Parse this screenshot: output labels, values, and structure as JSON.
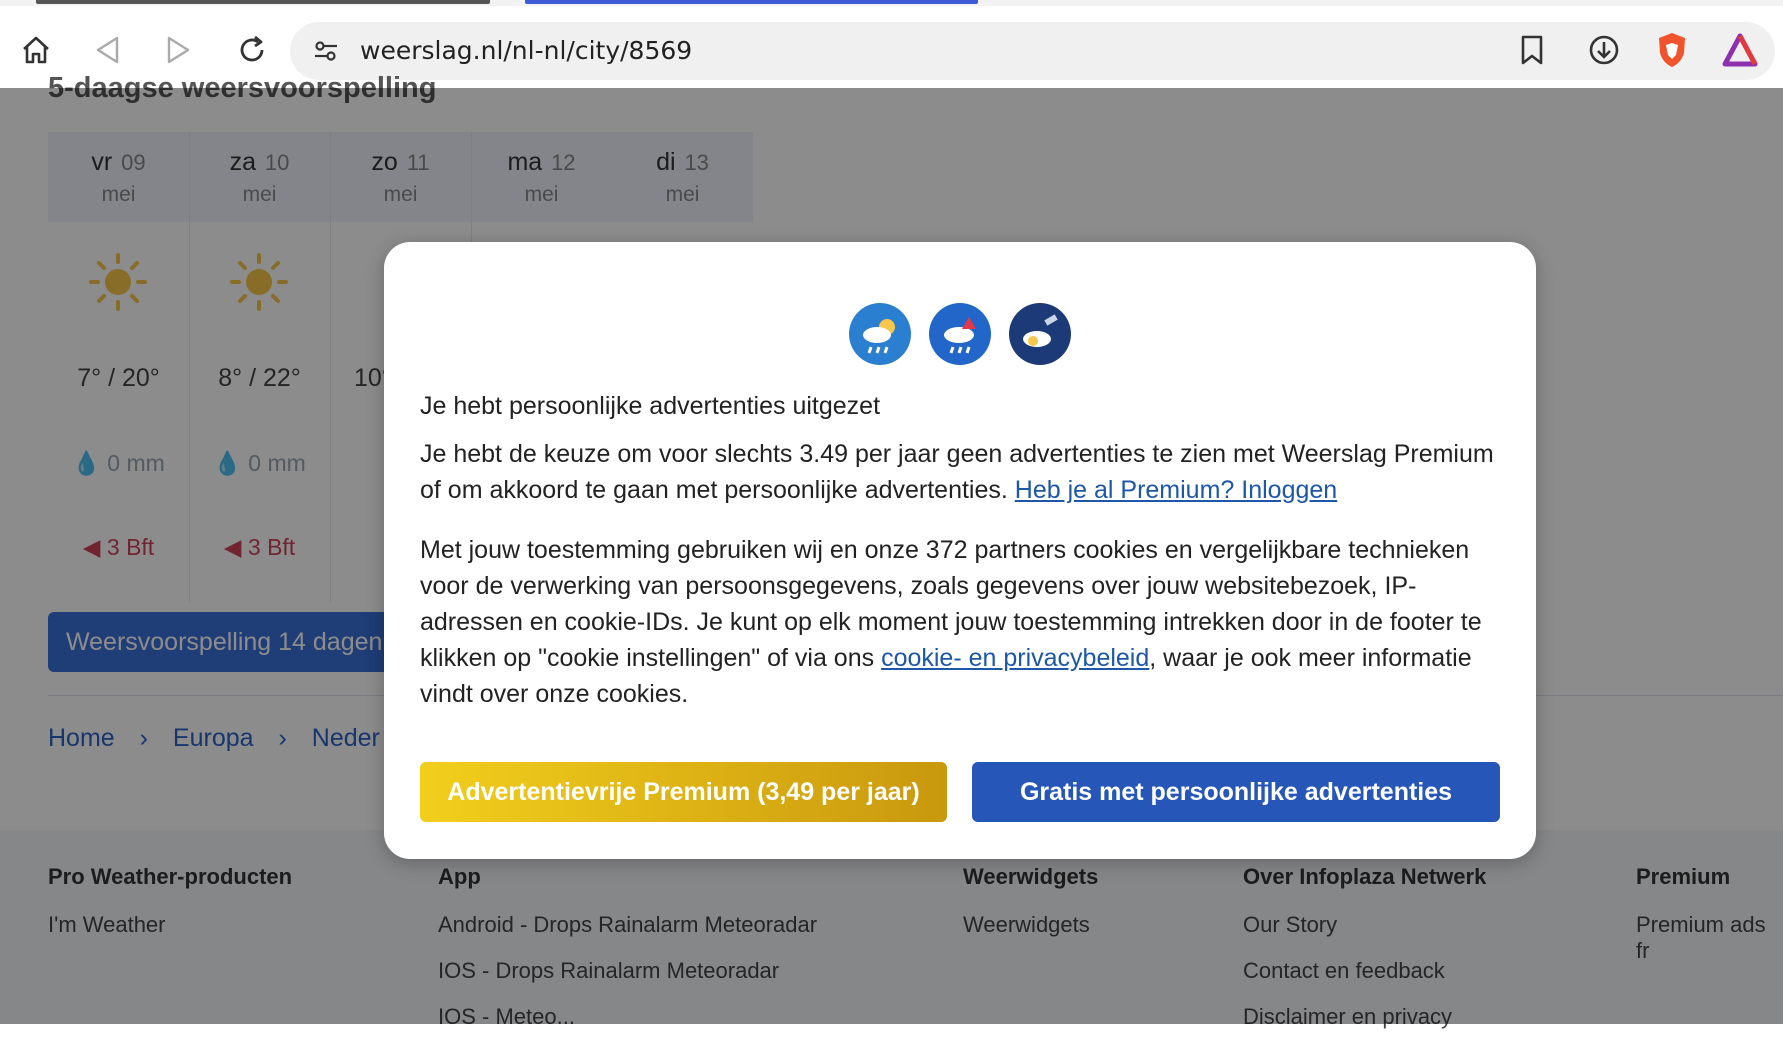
{
  "browser": {
    "url": "weerslag.nl/nl-nl/city/8569",
    "icons": [
      "home-icon",
      "back-icon",
      "forward-icon",
      "reload-icon",
      "site-settings-icon",
      "bookmark-icon",
      "download-icon",
      "brave-shield-icon",
      "brave-rewards-icon"
    ]
  },
  "page": {
    "title": "5-daagse weersvoorspelling",
    "days": [
      {
        "name": "vr",
        "date": "09",
        "month": "mei",
        "temp": "7° / 20°",
        "rain": "0 mm",
        "wind": "3 Bft"
      },
      {
        "name": "za",
        "date": "10",
        "month": "mei",
        "temp": "8° / 22°",
        "rain": "0 mm",
        "wind": "3 Bft"
      },
      {
        "name": "zo",
        "date": "11",
        "month": "mei",
        "temp": "10°",
        "rain": "",
        "wind": ""
      },
      {
        "name": "ma",
        "date": "12",
        "month": "mei",
        "temp": "",
        "rain": "",
        "wind": ""
      },
      {
        "name": "di",
        "date": "13",
        "month": "mei",
        "temp": "",
        "rain": "",
        "wind": ""
      }
    ],
    "forecast_button": "Weersvoorspelling 14 dagen",
    "breadcrumb": [
      "Home",
      "Europa",
      "Neder"
    ],
    "footer": {
      "col1": {
        "heading": "Pro Weather-producten",
        "links": [
          "I'm Weather"
        ]
      },
      "col2": {
        "heading": "App",
        "links": [
          "Android - Drops Rainalarm Meteoradar",
          "IOS - Drops Rainalarm Meteoradar",
          "IOS - Meteo..."
        ]
      },
      "col3": {
        "heading": "Weerwidgets",
        "links": [
          "Weerwidgets"
        ]
      },
      "col4": {
        "heading": "Over Infoplaza Netwerk",
        "links": [
          "Our Story",
          "Contact en feedback",
          "Disclaimer en privacy"
        ]
      },
      "col5": {
        "heading": "Premium",
        "links": [
          "Premium ads fr"
        ]
      }
    }
  },
  "modal": {
    "heading": "Je hebt persoonlijke advertenties uitgezet",
    "p1_text": "Je hebt de keuze om voor slechts 3.49 per jaar geen advertenties te zien met Weerslag Premium of om akkoord te gaan met persoonlijke advertenties. ",
    "p1_link": "Heb je al Premium? Inloggen",
    "p2_text_a": "Met jouw toestemming gebruiken wij en onze 372 partners cookies en vergelijkbare technieken voor de verwerking van persoonsgegevens, zoals gegevens over jouw websitebezoek, IP-adressen en cookie-IDs. Je kunt op elk moment jouw toestemming intrekken door in de footer te klikken op \"cookie instellingen\" of via ons ",
    "p2_link": "cookie- en privacybeleid",
    "p2_text_b": ", waar je ook meer informatie vindt over onze cookies.",
    "btn_premium": "Advertentievrije Premium (3,49 per jaar)",
    "btn_free": "Gratis met persoonlijke advertenties"
  }
}
